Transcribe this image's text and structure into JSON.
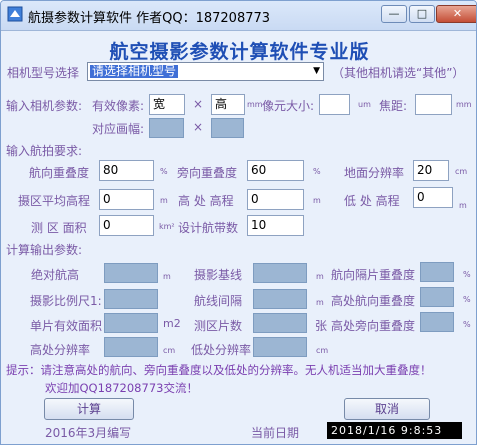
{
  "window": {
    "title": "航摄参数计算软件 作者QQ：187208773",
    "minimize_glyph": "—",
    "maximize_glyph": "□",
    "close_glyph": "✕"
  },
  "app_title": "航空摄影参数计算软件专业版",
  "camera_model": {
    "label": "相机型号选择",
    "selected": "请选择相机型号",
    "hint": "（其他相机请选“其他”）"
  },
  "camera_params": {
    "label": "输入相机参数:",
    "effective_pixels_label": "有效像素:",
    "width_value": "宽",
    "times_sign": "×",
    "height_value": "高",
    "mm_unit_small": "mm",
    "pixel_size_label": "像元大小:",
    "pixel_size_value": "",
    "um_unit": "um",
    "focal_label": "焦距:",
    "focal_value": "",
    "focal_unit": "mm",
    "diagonal_label": "对应画幅:"
  },
  "flight_requirements": {
    "label": "输入航拍要求:",
    "forward_overlap_label": "航向重叠度",
    "forward_overlap_value": "80",
    "percent": "%",
    "side_overlap_label": "旁向重叠度",
    "side_overlap_value": "60",
    "gsd_label": "地面分辨率",
    "gsd_value": "20",
    "cm_unit": "cm",
    "avg_elevation_label": "摄区平均高程",
    "avg_elevation_value": "0",
    "m_unit": "m",
    "high_elevation_label": "高 处 高程",
    "high_elevation_value": "0",
    "low_elevation_label": "低 处 高程",
    "low_elevation_value": "0",
    "area_label": "测 区 面积",
    "area_value": "0",
    "area_unit": "km²",
    "strips_label": "设计航带数",
    "strips_value": "10"
  },
  "outputs": {
    "label": "计算输出参数:",
    "abs_height_label": "绝对航高",
    "m_unit": "m",
    "baseline_label": "摄影基线",
    "strip_overlap_label": "航向隔片重叠度",
    "percent": "%",
    "scale_label": "摄影比例尺1:",
    "strip_spacing_label": "航线间隔",
    "high_forward_label": "高处航向重叠度",
    "single_area_label": "单片有效面积",
    "m2_unit": "m2",
    "photo_count_label": "测区片数",
    "photo_count_unit": "张",
    "high_side_label": "高处旁向重叠度",
    "high_res_label": "高处分辨率",
    "cm_unit": "cm",
    "low_res_label": "低处分辨率"
  },
  "tip": {
    "line1": "提示：请注意高处的航向、旁向重叠度以及低处的分辨率。无人机适当加大重叠度！",
    "line2": "欢迎加QQ187208773交流！"
  },
  "buttons": {
    "calculate": "计算",
    "cancel": "取消"
  },
  "footer": {
    "compiled": "2016年3月编写",
    "date_label": "当前日期",
    "date_value": "2018/1/16 9:8:53"
  }
}
